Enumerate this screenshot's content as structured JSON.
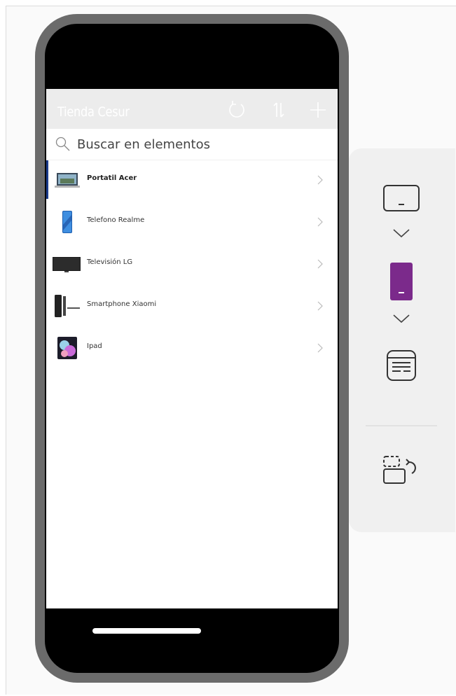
{
  "app": {
    "title": "Tienda Cesur",
    "header_icons": [
      "refresh-icon",
      "sort-icon",
      "add-icon"
    ]
  },
  "search": {
    "placeholder": "Buscar en elementos",
    "value": ""
  },
  "items": [
    {
      "label": "Portatil Acer",
      "thumb": "laptop-thumbnail",
      "selected": true
    },
    {
      "label": "Telefono Realme",
      "thumb": "phone-thumbnail",
      "selected": false
    },
    {
      "label": "Televisión LG",
      "thumb": "tv-thumbnail",
      "selected": false
    },
    {
      "label": "Smartphone Xiaomi",
      "thumb": "smartphone-thumbnail",
      "selected": false
    },
    {
      "label": "Ipad",
      "thumb": "tablet-thumbnail",
      "selected": false
    }
  ],
  "panel": {
    "buttons": [
      "tablet-layout-icon",
      "chevron-down-icon",
      "phone-layout-icon",
      "chevron-down-icon",
      "screen-layout-icon",
      "rotate-screen-icon"
    ],
    "accent_color": "#7b2a8b"
  },
  "colors": {
    "device_frame": "#6b6b6b",
    "header_bg": "#ececec",
    "selected_bar": "#1a3a8a"
  }
}
